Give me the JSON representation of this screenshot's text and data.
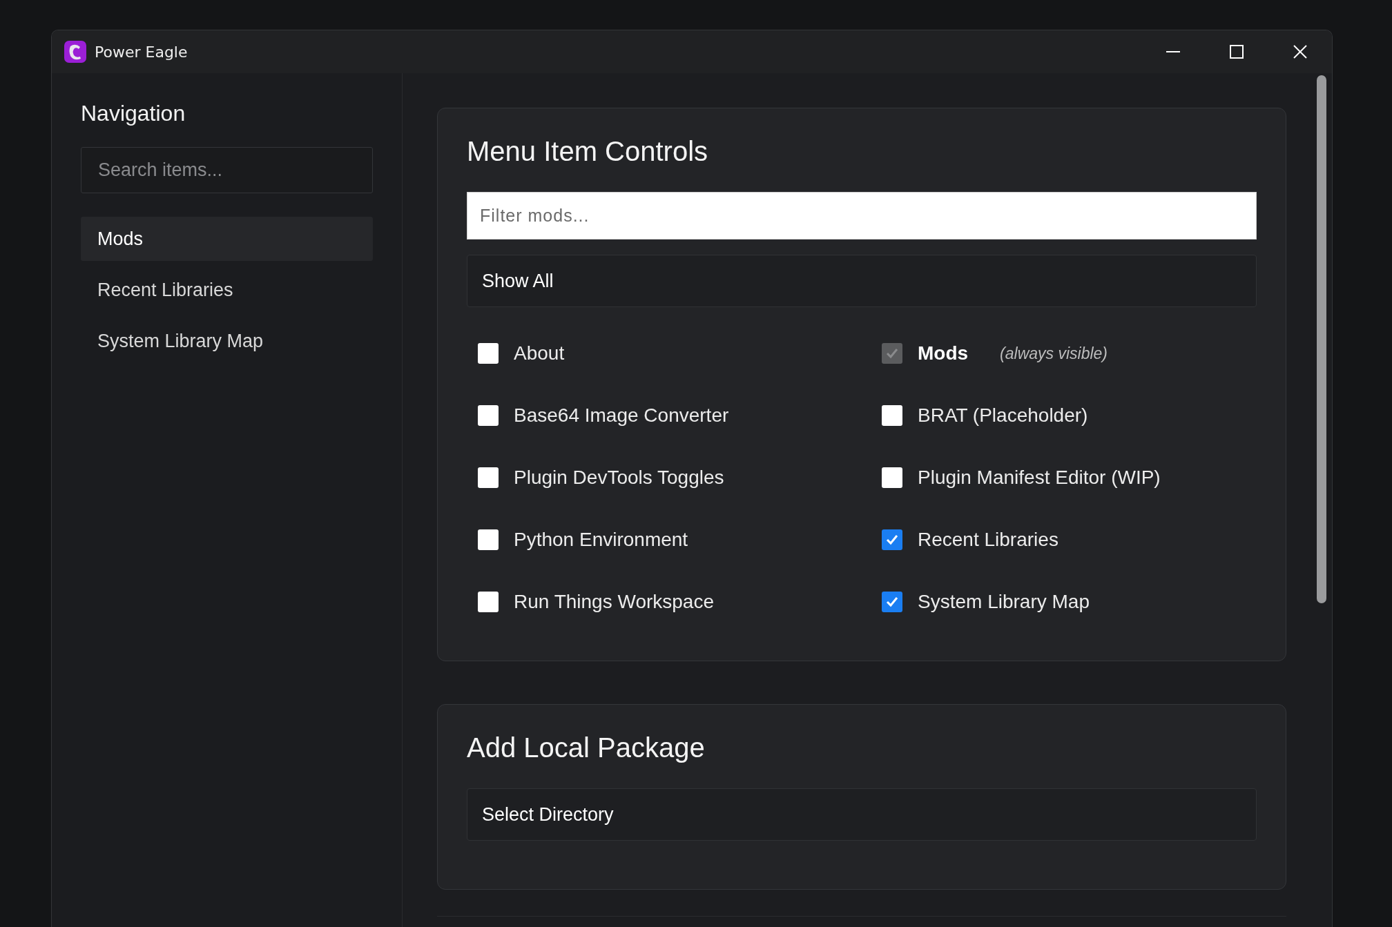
{
  "window": {
    "title": "Power Eagle"
  },
  "sidebar": {
    "heading": "Navigation",
    "search": {
      "placeholder": "Search items..."
    },
    "items": [
      {
        "label": "Mods",
        "selected": true
      },
      {
        "label": "Recent Libraries",
        "selected": false
      },
      {
        "label": "System Library Map",
        "selected": false
      }
    ]
  },
  "menu_item_controls": {
    "title": "Menu Item Controls",
    "filter": {
      "placeholder": "Filter mods..."
    },
    "button": "Show All",
    "items": [
      {
        "label": "About",
        "checked": false,
        "disabled": false
      },
      {
        "label": "Mods",
        "checked": true,
        "disabled": true,
        "note": "(always visible)"
      },
      {
        "label": "Base64 Image Converter",
        "checked": false,
        "disabled": false
      },
      {
        "label": "BRAT (Placeholder)",
        "checked": false,
        "disabled": false
      },
      {
        "label": "Plugin DevTools Toggles",
        "checked": false,
        "disabled": false
      },
      {
        "label": "Plugin Manifest Editor (WIP)",
        "checked": false,
        "disabled": false
      },
      {
        "label": "Python Environment",
        "checked": false,
        "disabled": false
      },
      {
        "label": "Recent Libraries",
        "checked": true,
        "disabled": false
      },
      {
        "label": "Run Things Workspace",
        "checked": false,
        "disabled": false
      },
      {
        "label": "System Library Map",
        "checked": true,
        "disabled": false
      }
    ]
  },
  "add_local_package": {
    "title": "Add Local Package",
    "button": "Select Directory"
  }
}
